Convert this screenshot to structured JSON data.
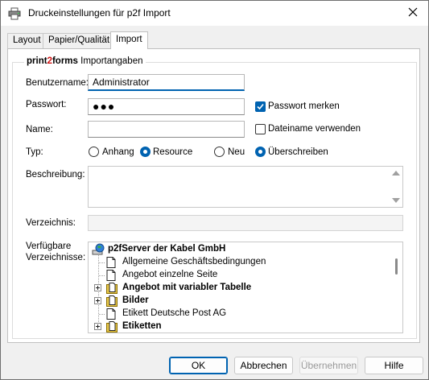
{
  "window": {
    "title": "Druckeinstellungen für p2f Import"
  },
  "tabs": [
    {
      "label": "Layout"
    },
    {
      "label": "Papier/Qualität"
    },
    {
      "label": "Import"
    }
  ],
  "group": {
    "brand_pre": "print",
    "brand_mid": "2",
    "brand_post": "forms",
    "title": "Importangaben"
  },
  "fields": {
    "username_label": "Benutzername:",
    "username_value": "Administrator",
    "password_label": "Passwort:",
    "password_dots": "●●●",
    "remember_password_label": "Passwort merken",
    "remember_password_checked": true,
    "name_label": "Name:",
    "name_value": "",
    "use_filename_label": "Dateiname verwenden",
    "use_filename_checked": false,
    "type_label": "Typ:",
    "type_options": [
      {
        "label": "Anhang",
        "checked": false
      },
      {
        "label": "Resource",
        "checked": true
      }
    ],
    "mode_options": [
      {
        "label": "Neu",
        "checked": false
      },
      {
        "label": "Überschreiben",
        "checked": true
      }
    ],
    "description_label": "Beschreibung:",
    "description_value": "",
    "directory_label": "Verzeichnis:",
    "directory_value": "",
    "available_dirs_label_1": "Verfügbare",
    "available_dirs_label_2": "Verzeichnisse:"
  },
  "tree": {
    "items": [
      {
        "label": "p2fServer der Kabel GmbH",
        "bold": true,
        "kind": "server",
        "expander": false
      },
      {
        "label": "Allgemeine Geschäftsbedingungen",
        "bold": false,
        "kind": "document",
        "expander": false
      },
      {
        "label": "Angebot einzelne Seite",
        "bold": false,
        "kind": "document",
        "expander": false
      },
      {
        "label": "Angebot mit variabler Tabelle",
        "bold": true,
        "kind": "folder-document",
        "expander": true
      },
      {
        "label": "Bilder",
        "bold": true,
        "kind": "folder-document",
        "expander": true
      },
      {
        "label": "Etikett Deutsche Post AG",
        "bold": false,
        "kind": "document",
        "expander": false
      },
      {
        "label": "Etiketten",
        "bold": true,
        "kind": "folder-document",
        "expander": true
      }
    ]
  },
  "buttons": {
    "ok": "OK",
    "cancel": "Abbrechen",
    "apply": "Übernehmen",
    "help": "Hilfe"
  },
  "colors": {
    "accent": "#0063b1",
    "brand_red": "#d01616"
  }
}
